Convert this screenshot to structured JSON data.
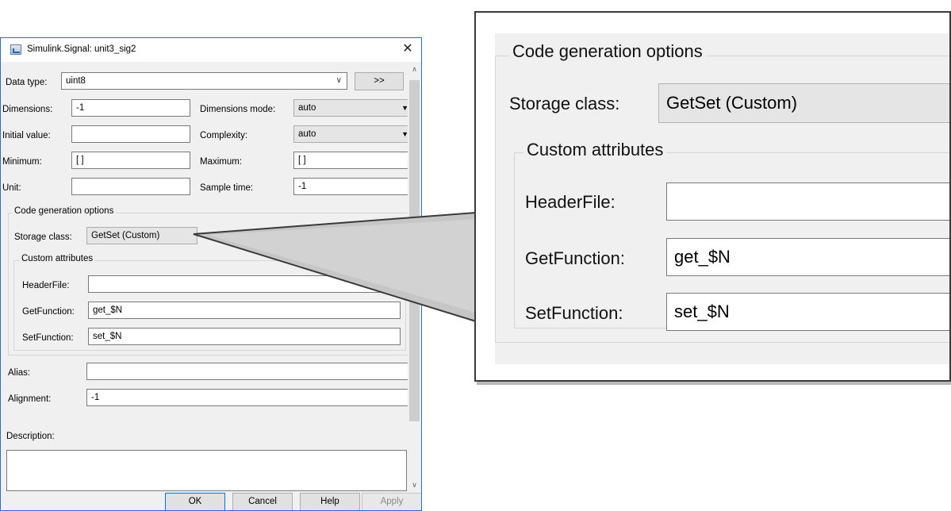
{
  "dialog": {
    "title": "Simulink.Signal: unit3_sig2",
    "close_glyph": "✕",
    "data_type_label": "Data type:",
    "data_type_value": "uint8",
    "more_button_label": ">>",
    "dimensions_label": "Dimensions:",
    "dimensions_value": "-1",
    "dimensions_mode_label": "Dimensions mode:",
    "dimensions_mode_value": "auto",
    "initial_value_label": "Initial value:",
    "initial_value_value": "",
    "complexity_label": "Complexity:",
    "complexity_value": "auto",
    "minimum_label": "Minimum:",
    "minimum_value": "[ ]",
    "maximum_label": "Maximum:",
    "maximum_value": "[ ]",
    "unit_label": "Unit:",
    "unit_value": "",
    "sample_time_label": "Sample time:",
    "sample_time_value": "-1",
    "codegen": {
      "group_title": "Code generation options",
      "storage_class_label": "Storage class:",
      "storage_class_value": "GetSet (Custom)",
      "custom_attributes_title": "Custom attributes",
      "header_file_label": "HeaderFile:",
      "header_file_value": "",
      "get_function_label": "GetFunction:",
      "get_function_value": "get_$N",
      "set_function_label": "SetFunction:",
      "set_function_value": "set_$N"
    },
    "alias_label": "Alias:",
    "alias_value": "",
    "alignment_label": "Alignment:",
    "alignment_value": "-1",
    "description_label": "Description:",
    "description_value": "",
    "buttons": {
      "ok": "OK",
      "cancel": "Cancel",
      "help": "Help",
      "apply": "Apply"
    },
    "accent_color": "#0078d7"
  },
  "zoom": {
    "group_title": "Code generation options",
    "storage_class_label": "Storage class:",
    "storage_class_value": "GetSet (Custom)",
    "custom_attributes_title": "Custom attributes",
    "header_file_label": "HeaderFile:",
    "header_file_value": "",
    "get_function_label": "GetFunction:",
    "get_function_value": "get_$N",
    "set_function_label": "SetFunction:",
    "set_function_value": "set_$N"
  }
}
